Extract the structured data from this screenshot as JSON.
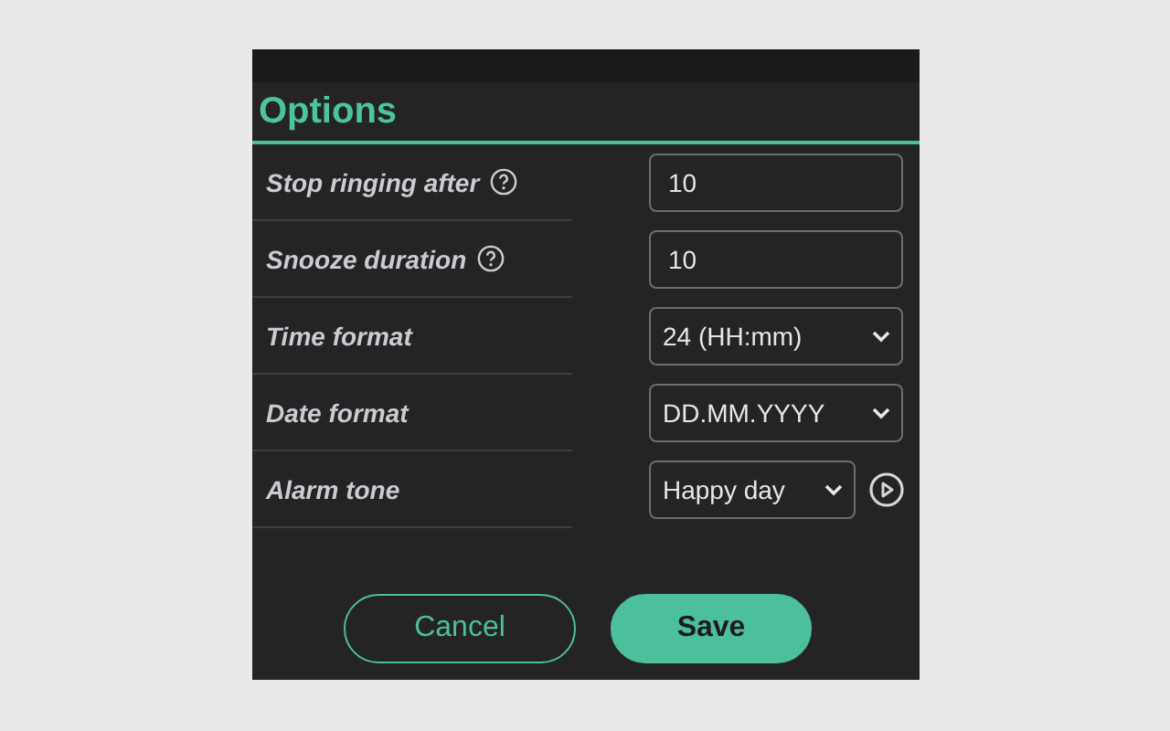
{
  "title": "Options",
  "settings": [
    {
      "label": "Stop ringing after",
      "help": true,
      "kind": "input",
      "value": "10"
    },
    {
      "label": "Snooze duration",
      "help": true,
      "kind": "input",
      "value": "10"
    },
    {
      "label": "Time format",
      "help": false,
      "kind": "select",
      "value": "24 (HH:mm)"
    },
    {
      "label": "Date format",
      "help": false,
      "kind": "select",
      "value": "DD.MM.YYYY"
    },
    {
      "label": "Alarm tone",
      "help": false,
      "kind": "tone",
      "value": "Happy day"
    }
  ],
  "buttons": [
    {
      "label": "Cancel",
      "kind": "secondary"
    },
    {
      "label": "Save",
      "kind": "primary"
    }
  ]
}
